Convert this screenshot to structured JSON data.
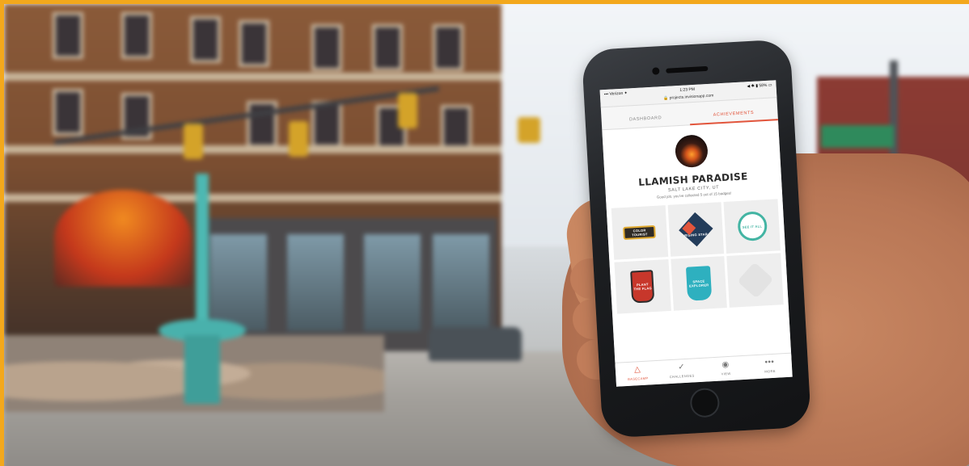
{
  "phone": {
    "status": {
      "carrier": "▪▪▪ Verizon ✦",
      "time": "1:23 PM",
      "battery": "◀ ✱ ▮ 58% ▭"
    },
    "url": "🔒 projects.invisionapp.com",
    "tabs": [
      {
        "label": "DASHBOARD",
        "active": false
      },
      {
        "label": "ACHIEVEMENTS",
        "active": true
      }
    ],
    "profile": {
      "name": "LLAMISH PARADISE",
      "location": "SALT LAKE CITY, UT",
      "message": "Good job, you've collected 5 out of 15 badges!"
    },
    "badges": [
      {
        "label": "COLOR TOURIST",
        "icon": "banner-badge-icon"
      },
      {
        "label": "RISING STAR",
        "icon": "star-badge-icon"
      },
      {
        "label": "SEE IT ALL",
        "icon": "circle-badge-icon"
      },
      {
        "label": "PLANT THE FLAG",
        "icon": "flag-badge-icon"
      },
      {
        "label": "SPACE EXPLORER",
        "icon": "moon-badge-icon"
      },
      {
        "label": "",
        "icon": "locked-badge-icon"
      }
    ],
    "nav": [
      {
        "label": "BASECAMP",
        "icon": "mountain-icon",
        "active": true
      },
      {
        "label": "CHALLENGES",
        "icon": "check-circle-icon",
        "active": false
      },
      {
        "label": "VIEW",
        "icon": "eye-icon",
        "active": false
      },
      {
        "label": "MORE",
        "icon": "more-icon",
        "active": false
      }
    ],
    "colors": {
      "accent": "#e2553c"
    }
  },
  "frame_color": "#f3a81c"
}
